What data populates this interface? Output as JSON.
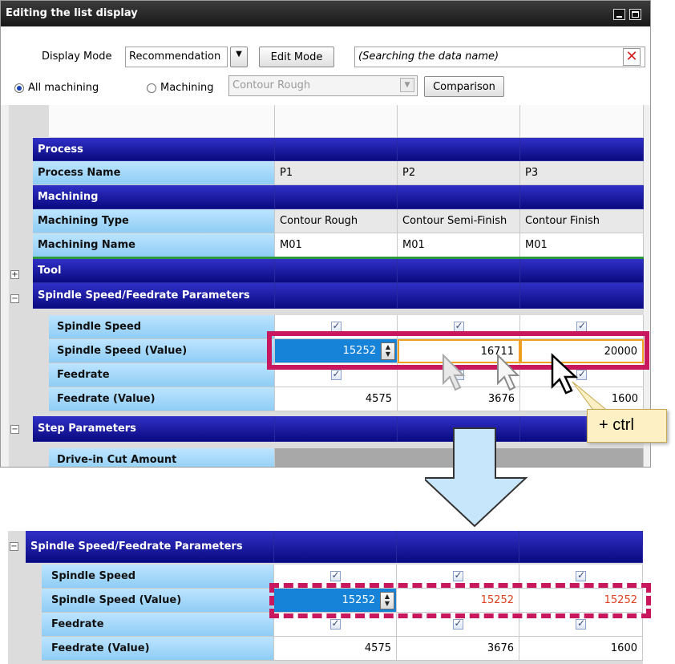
{
  "window": {
    "title": "Editing the list display"
  },
  "toolbar": {
    "display_mode_label": "Display Mode",
    "display_mode_value": "Recommendation",
    "edit_mode_button": "Edit Mode",
    "search_placeholder": "(Searching the data name)",
    "all_machining_label": "All machining",
    "machining_label": "Machining",
    "machining_select_value": "Contour Rough",
    "comparison_button": "Comparison"
  },
  "grid": {
    "groups": {
      "process": "Process",
      "machining": "Machining",
      "tool": "Tool",
      "spindle": "Spindle Speed/Feedrate Parameters",
      "step": "Step Parameters"
    },
    "rows": {
      "process_name": {
        "label": "Process Name",
        "values": [
          "P1",
          "P2",
          "P3"
        ]
      },
      "machining_type": {
        "label": "Machining Type",
        "values": [
          "Contour Rough",
          "Contour Semi-Finish",
          "Contour Finish"
        ]
      },
      "machining_name": {
        "label": "Machining Name",
        "values": [
          "M01",
          "M01",
          "M01"
        ]
      },
      "spindle_speed": {
        "label": "Spindle Speed"
      },
      "spindle_speed_value": {
        "label": "Spindle Speed (Value)",
        "values": [
          "15252",
          "16711",
          "20000"
        ]
      },
      "feedrate": {
        "label": "Feedrate"
      },
      "feedrate_value": {
        "label": "Feedrate (Value)",
        "values": [
          "4575",
          "3676",
          "1600"
        ]
      },
      "drive_in": {
        "label": "Drive-in Cut Amount"
      }
    }
  },
  "callout": {
    "text": "+ ctrl"
  },
  "result": {
    "group": "Spindle Speed/Feedrate Parameters",
    "spindle_speed": "Spindle Speed",
    "spindle_speed_value": {
      "label": "Spindle Speed (Value)",
      "values": [
        "15252",
        "15252",
        "15252"
      ]
    },
    "feedrate": "Feedrate",
    "feedrate_value": {
      "label": "Feedrate (Value)",
      "values": [
        "4575",
        "3676",
        "1600"
      ]
    }
  },
  "colors": {
    "highlight": "#c8175d",
    "selected": "#1683d8",
    "header": "#0a0a80",
    "changed_text": "#e04020"
  }
}
